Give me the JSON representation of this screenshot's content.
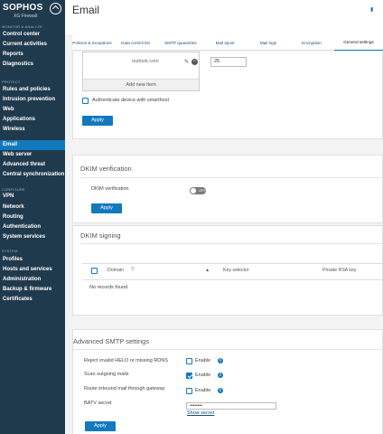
{
  "app": {
    "brand": "SOPHOS",
    "product": "XG Firewall"
  },
  "sidebar": {
    "sections": [
      {
        "label": "MONITOR & ANALYZE",
        "items": [
          "Control center",
          "Current activities",
          "Reports",
          "Diagnostics"
        ]
      },
      {
        "label": "PROTECT",
        "items": [
          "Rules and policies",
          "Intrusion prevention",
          "Web",
          "Applications",
          "Wireless",
          "Email",
          "Web server",
          "Advanced threat",
          "Central synchronization"
        ]
      },
      {
        "label": "CONFIGURE",
        "items": [
          "VPN",
          "Network",
          "Routing",
          "Authentication",
          "System services"
        ]
      },
      {
        "label": "SYSTEM",
        "items": [
          "Profiles",
          "Hosts and services",
          "Administration",
          "Backup & firmware",
          "Certificates"
        ]
      }
    ],
    "active": "Email"
  },
  "header": {
    "title": "Email"
  },
  "tabs": [
    {
      "label": "Policies & exceptions",
      "active": false
    },
    {
      "label": "Data control list",
      "active": false
    },
    {
      "label": "SMTP quarantine",
      "active": false
    },
    {
      "label": "Mail spool",
      "active": false
    },
    {
      "label": "Mail logs",
      "active": false
    },
    {
      "label": "Encryption",
      "active": false
    },
    {
      "label": "General settings",
      "active": true
    }
  ],
  "smarthost": {
    "host_list": [
      "outlook.com"
    ],
    "add_new_item": "Add new item",
    "port_value": "25",
    "authenticate_label": "Authenticate device with smarthost",
    "authenticate_checked": false,
    "apply_label": "Apply"
  },
  "dkim_verification": {
    "title": "DKIM verification",
    "field_label": "DKIM verification",
    "toggle_text": "OFF",
    "enabled": false,
    "apply_label": "Apply"
  },
  "dkim_signing": {
    "title": "DKIM signing",
    "columns": [
      "Domain",
      "Key selector",
      "Private RSA key"
    ],
    "empty_text": "No records found"
  },
  "advanced_smtp": {
    "title": "Advanced SMTP settings",
    "rows": [
      {
        "label": "Reject invalid HELO or missing RDNS",
        "option": "Enable",
        "checked": false
      },
      {
        "label": "Scan outgoing mails",
        "option": "Enable",
        "checked": true
      },
      {
        "label": "Route inbound mail through gateway",
        "option": "Enable",
        "checked": false
      }
    ],
    "batv_label": "BATV secret",
    "batv_value": "••••••••",
    "show_secret": "Show secret",
    "apply_label": "Apply"
  },
  "colors": {
    "sidebar_bg": "#1f3a4c",
    "accent": "#1279bd"
  }
}
